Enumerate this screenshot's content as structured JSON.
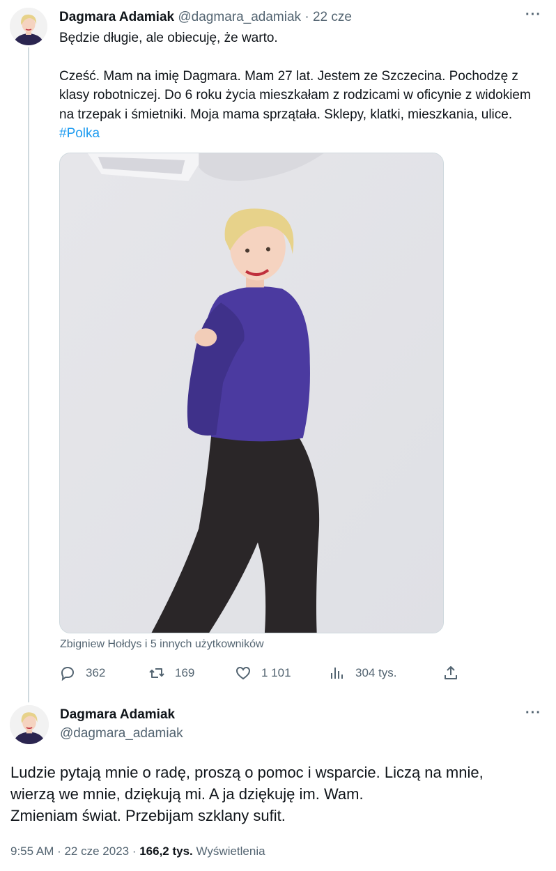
{
  "tweet1": {
    "author_name": "Dagmara Adamiak",
    "handle": "@dagmara_adamiak",
    "separator": "·",
    "date": "22 cze",
    "more_label": "···",
    "line1": "Będzie długie, ale obiecuję, że warto.",
    "body": "Cześć. Mam na imię Dagmara. Mam 27 lat. Jestem ze Szczecina. Pochodzę z klasy robotniczej. Do 6 roku życia mieszkałam z rodzicami w oficynie z widokiem na trzepak i śmietniki. Moja mama sprzątała. Sklepy, klatki, mieszkania, ulice.",
    "hashtag": "#Polka",
    "tagged": "Zbigniew Hołdys i 5 innych użytkowników",
    "actions": {
      "replies": "362",
      "retweets": "169",
      "likes": "1 101",
      "views": "304 tys."
    },
    "icons": {
      "reply": "reply-icon",
      "retweet": "retweet-icon",
      "like": "heart-icon",
      "views": "views-chart-icon",
      "share": "share-icon"
    }
  },
  "tweet2": {
    "author_name": "Dagmara Adamiak",
    "handle": "@dagmara_adamiak",
    "more_label": "···",
    "line1": "Ludzie pytają mnie o radę, proszą o pomoc i wsparcie. Liczą na mnie,",
    "line2": "wierzą we mnie, dziękują mi. A ja dziękuję im. Wam.",
    "line3": "Zmieniam świat. Przebijam szklany sufit.",
    "timestamp": "9:55 AM · 22 cze 2023 · ",
    "views_count": "166,2 tys.",
    "views_label": "Wyświetlenia"
  },
  "colors": {
    "text": "#0f1419",
    "secondary": "#536471",
    "link": "#1d9bf0",
    "line": "#cfd9de",
    "shirt": "#4b3aa0"
  }
}
